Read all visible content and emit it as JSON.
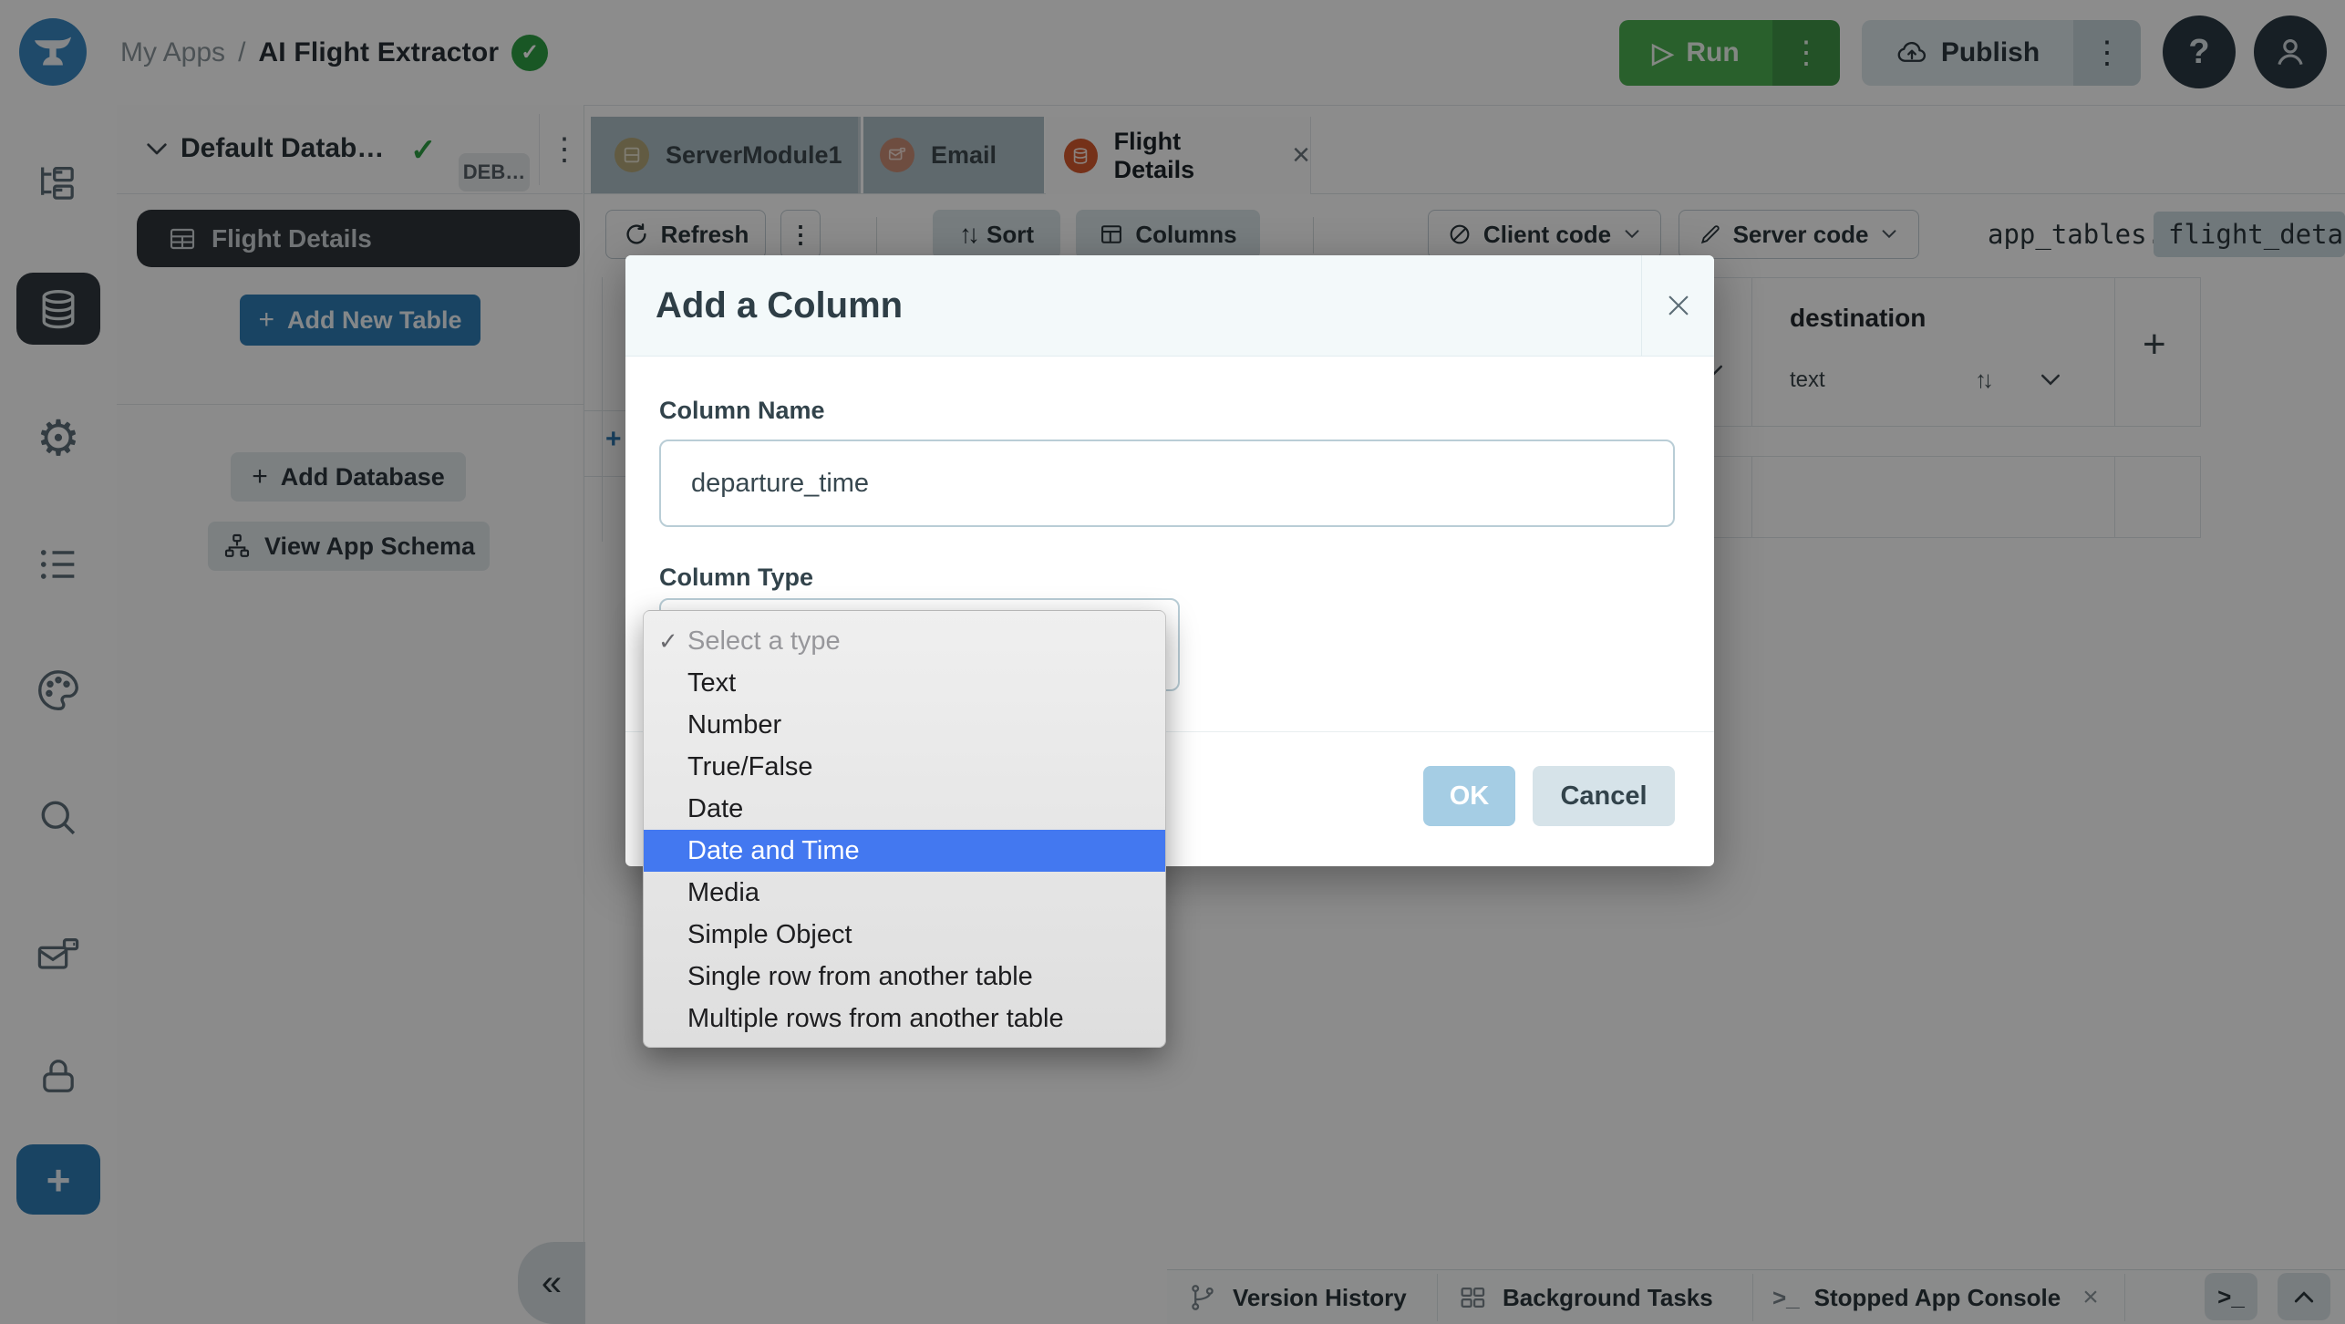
{
  "topbar": {
    "breadcrumb_root": "My Apps",
    "breadcrumb_sep": "/",
    "app_name": "AI Flight Extractor",
    "run_label": "Run",
    "publish_label": "Publish"
  },
  "icons": {
    "check": "✓",
    "play": "▷",
    "kebab": "⋮",
    "question": "?",
    "sort_arrows": "↑↓",
    "plus": "+",
    "close": "×",
    "chevrons_left": "«",
    "terminal_prompt": "&gt;_",
    "terminal_text": ">_",
    "gear": "⚙"
  },
  "colors": {
    "run_green": "#4caf50",
    "primary_blue": "#2f7cb5",
    "selection_blue": "#4378f0",
    "check_green": "#2f9e44",
    "tab_dot_flight": "#d6592f",
    "tab_dot_email": "#c98d76",
    "tab_dot_server": "#b3a678",
    "overlay": "rgba(0,0,0,0.45)"
  },
  "sidebar": {
    "items": [
      {
        "icon": "app-browser-icon"
      },
      {
        "icon": "database-icon",
        "selected": true
      },
      {
        "icon": "settings-gear-icon"
      },
      {
        "icon": "list-icon"
      },
      {
        "icon": "theme-palette-icon"
      },
      {
        "icon": "search-icon"
      },
      {
        "icon": "email-services-icon"
      },
      {
        "icon": "security-lock-icon"
      },
      {
        "icon": "add-plus-icon"
      }
    ]
  },
  "panel": {
    "database_title": "Default Datab…",
    "debug_badge": "DEB…",
    "table_item": "Flight Details",
    "add_new_table": "Add New Table",
    "add_database": "Add Database",
    "view_app_schema": "View App Schema"
  },
  "tabs": [
    {
      "label": "ServerModule1"
    },
    {
      "label": "Email"
    },
    {
      "label": "Flight Details",
      "active": true,
      "closable": true
    }
  ],
  "toolbar": {
    "refresh": "Refresh",
    "sort": "Sort",
    "columns": "Columns",
    "client_code": "Client code",
    "server_code": "Server code",
    "table_ref_prefix": "app_tables.",
    "table_ref_chip": "flight_deta"
  },
  "table": {
    "column_name": "destination",
    "column_type": "text"
  },
  "modal": {
    "title": "Add a Column",
    "column_name_label": "Column Name",
    "column_name_value": "departure_time",
    "column_type_label": "Column Type",
    "ok": "OK",
    "cancel": "Cancel"
  },
  "type_menu": {
    "items": [
      {
        "label": "Select a type",
        "checked": true,
        "muted": true
      },
      {
        "label": "Text"
      },
      {
        "label": "Number"
      },
      {
        "label": "True/False"
      },
      {
        "label": "Date"
      },
      {
        "label": "Date and Time",
        "selected": true
      },
      {
        "label": "Media"
      },
      {
        "label": "Simple Object"
      },
      {
        "label": "Single row from another table"
      },
      {
        "label": "Multiple rows from another table"
      }
    ]
  },
  "bottombar": {
    "tabs": [
      {
        "label": "Version History"
      },
      {
        "label": "Background Tasks"
      },
      {
        "label": "Stopped App Console",
        "closable": true
      }
    ]
  }
}
